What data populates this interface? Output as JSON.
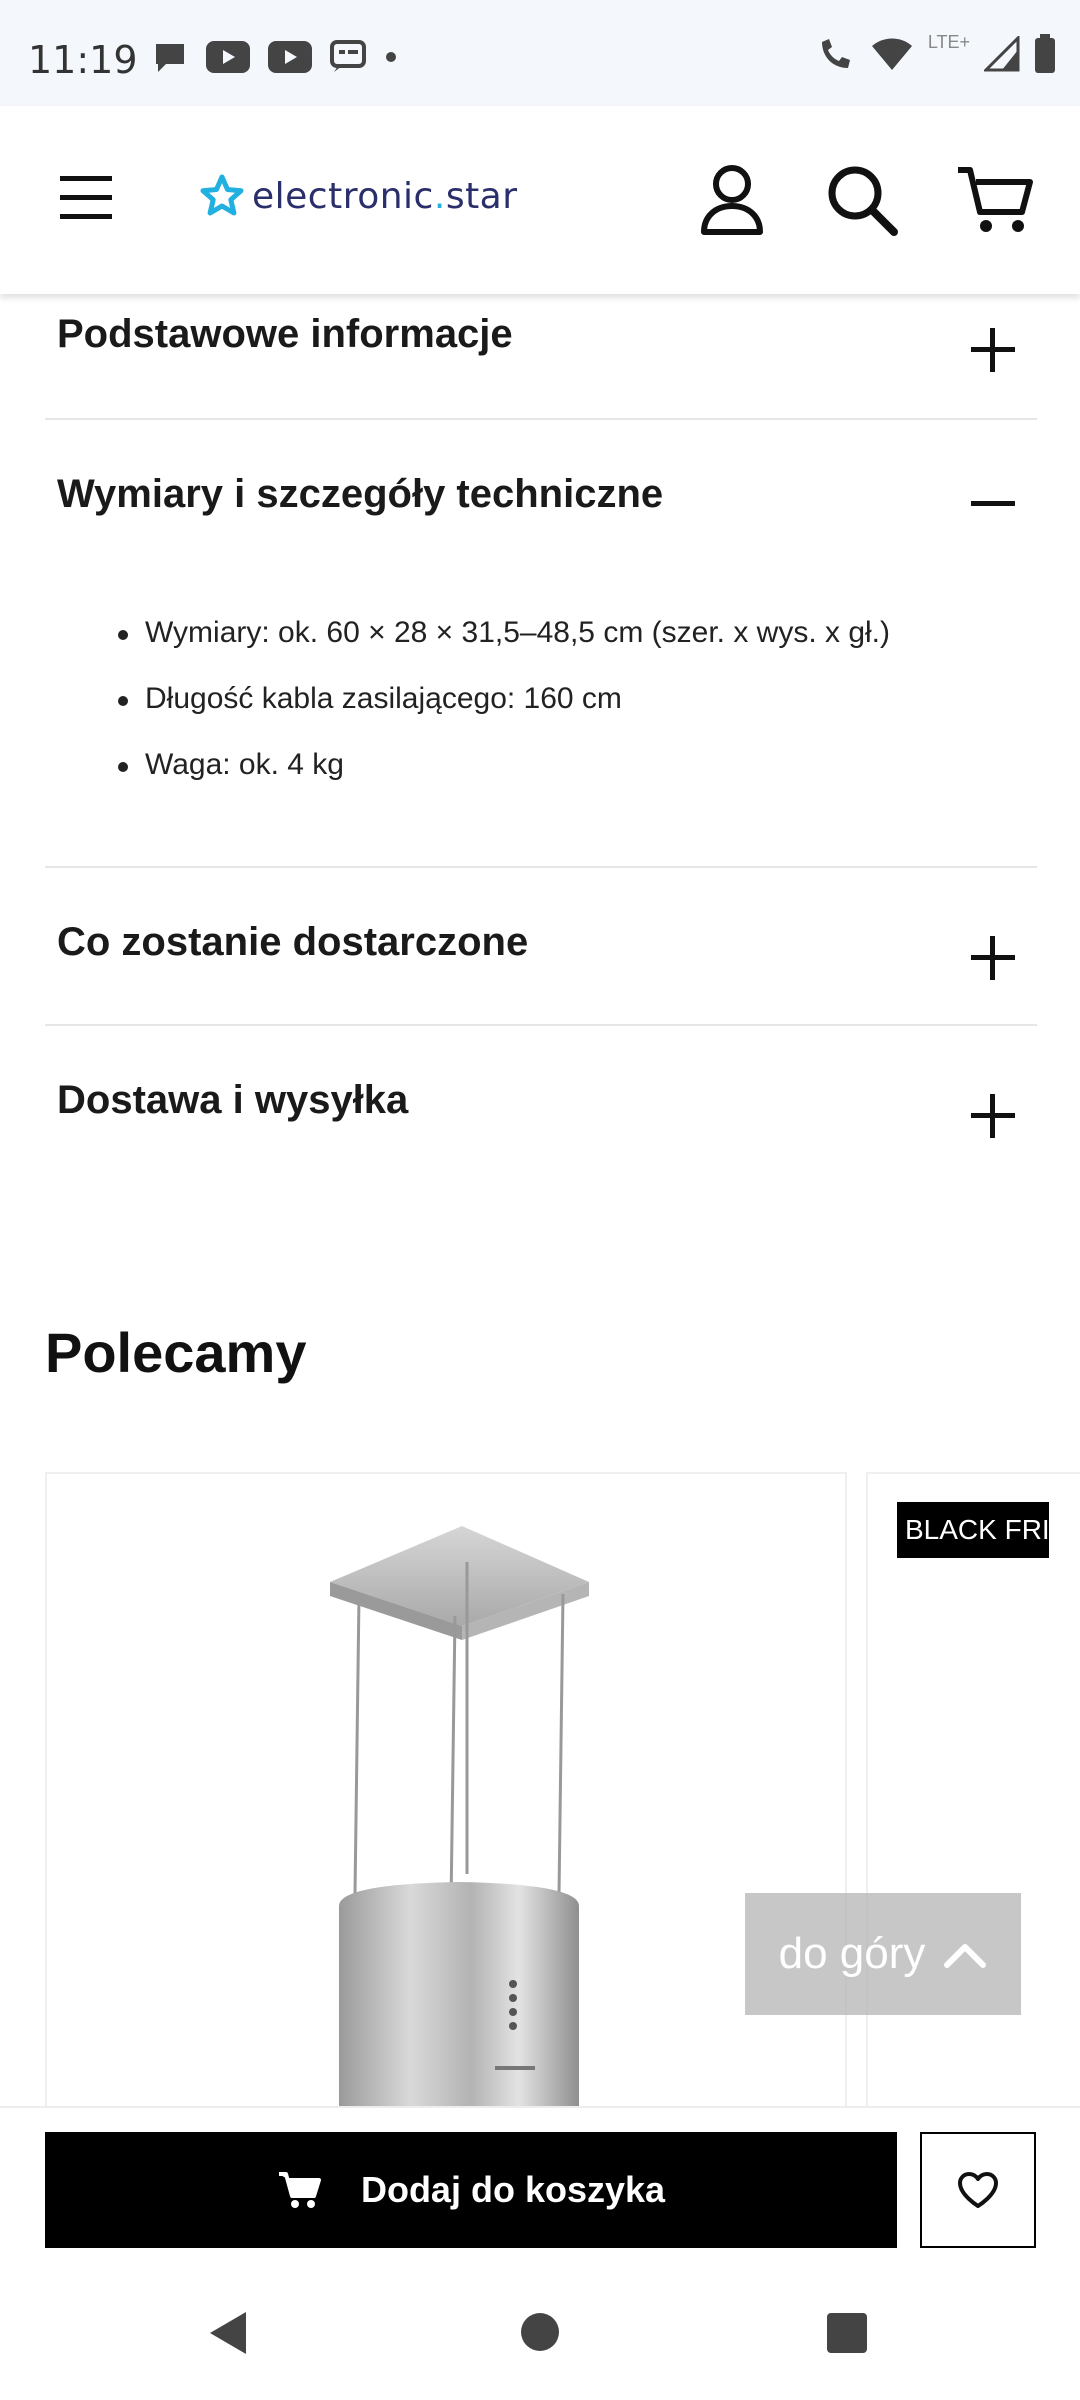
{
  "status": {
    "time": "11:19",
    "network_label": "LTE+"
  },
  "header": {
    "logo_prefix": "electronic",
    "logo_dot": ".",
    "logo_suffix": "star",
    "icons": [
      "menu-icon",
      "user-icon",
      "search-icon",
      "cart-icon"
    ]
  },
  "accordion": [
    {
      "title": "Podstawowe informacje",
      "state": "collapsed"
    },
    {
      "title": "Wymiary i szczegóły techniczne",
      "state": "expanded",
      "items": [
        "Wymiary: ok. 60 × 28 × 31,5–48,5 cm (szer. x wys. x gł.)",
        "Długość kabla zasilającego: 160 cm",
        "Waga: ok. 4 kg"
      ]
    },
    {
      "title": "Co zostanie dostarczone",
      "state": "collapsed"
    },
    {
      "title": "Dostawa i wysyłka",
      "state": "collapsed"
    }
  ],
  "recommend": {
    "title": "Polecamy",
    "badge": "BLACK FRI"
  },
  "scroll_top": {
    "label": "do góry"
  },
  "bottom_bar": {
    "add_to_cart": "Dodaj do koszyka"
  },
  "colors": {
    "accent": "#22b0e0",
    "logo_text": "#2a2f6b",
    "button_bg": "#000000"
  }
}
